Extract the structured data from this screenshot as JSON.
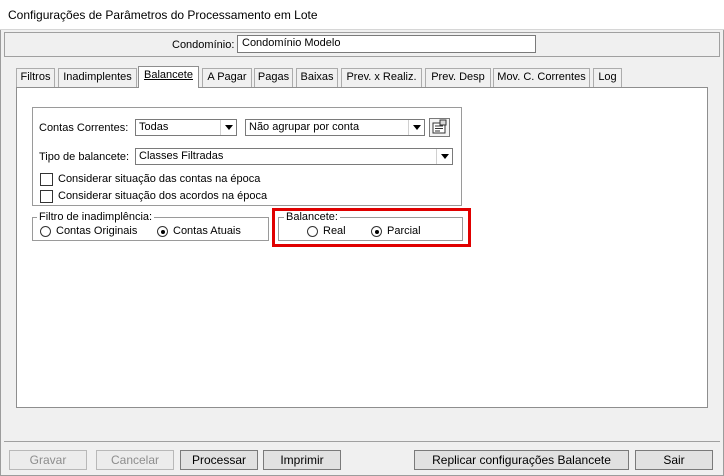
{
  "window": {
    "title": "Configurações de Parâmetros do Processamento em Lote"
  },
  "condominio": {
    "label": "Condomínio:",
    "value": "Condomínio Modelo"
  },
  "tabs": [
    {
      "label": "Filtros"
    },
    {
      "label": "Inadimplentes"
    },
    {
      "label": "Balancete",
      "active": true
    },
    {
      "label": "A Pagar"
    },
    {
      "label": "Pagas"
    },
    {
      "label": "Baixas"
    },
    {
      "label": "Prev. x Realiz."
    },
    {
      "label": "Prev. Desp"
    },
    {
      "label": "Mov. C. Correntes"
    },
    {
      "label": "Log"
    }
  ],
  "balancete_tab": {
    "contas_correntes": {
      "label": "Contas Correntes:",
      "value": "Todas",
      "agrupar_value": "Não agrupar por conta"
    },
    "tipo_balancete": {
      "label": "Tipo de balancete:",
      "value": "Classes Filtradas"
    },
    "checkboxes": [
      {
        "label": "Considerar situação das contas na época",
        "checked": false
      },
      {
        "label": "Considerar situação dos acordos na época",
        "checked": false
      }
    ],
    "filtro_inadimplencia": {
      "title": "Filtro de inadimplência:",
      "options": [
        {
          "label": "Contas Originais",
          "selected": false
        },
        {
          "label": "Contas Atuais",
          "selected": true
        }
      ]
    },
    "balancete_group": {
      "title": "Balancete:",
      "options": [
        {
          "label": "Real",
          "selected": false
        },
        {
          "label": "Parcial",
          "selected": true
        }
      ]
    }
  },
  "buttons": {
    "gravar": "Gravar",
    "cancelar": "Cancelar",
    "processar": "Processar",
    "imprimir": "Imprimir",
    "replicar": "Replicar configurações Balancete",
    "sair": "Sair"
  },
  "colors": {
    "highlight": "#e00000",
    "panel": "#ffffff",
    "window": "#f0f0f0"
  }
}
